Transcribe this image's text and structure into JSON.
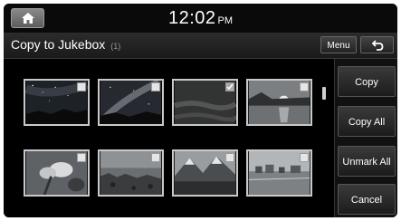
{
  "status": {
    "time": "12:02",
    "ampm": "PM",
    "home_icon": "home-icon"
  },
  "header": {
    "title": "Copy to Jukebox",
    "count": "(1)",
    "menu_label": "Menu",
    "back_icon": "back-arrow-icon"
  },
  "thumbnails": [
    {
      "scene": "starry-night-sky",
      "checked": false
    },
    {
      "scene": "milky-way-night",
      "checked": false
    },
    {
      "scene": "dark-forest-texture",
      "checked": true
    },
    {
      "scene": "sunrise-over-lake",
      "checked": false
    },
    {
      "scene": "flower-closeup",
      "checked": false
    },
    {
      "scene": "rocky-coastline",
      "checked": false
    },
    {
      "scene": "mountain-lake",
      "checked": false
    },
    {
      "scene": "seaside-town",
      "checked": false
    }
  ],
  "actions": {
    "copy": "Copy",
    "copy_all": "Copy All",
    "unmark_all": "Unmark All",
    "cancel": "Cancel"
  }
}
